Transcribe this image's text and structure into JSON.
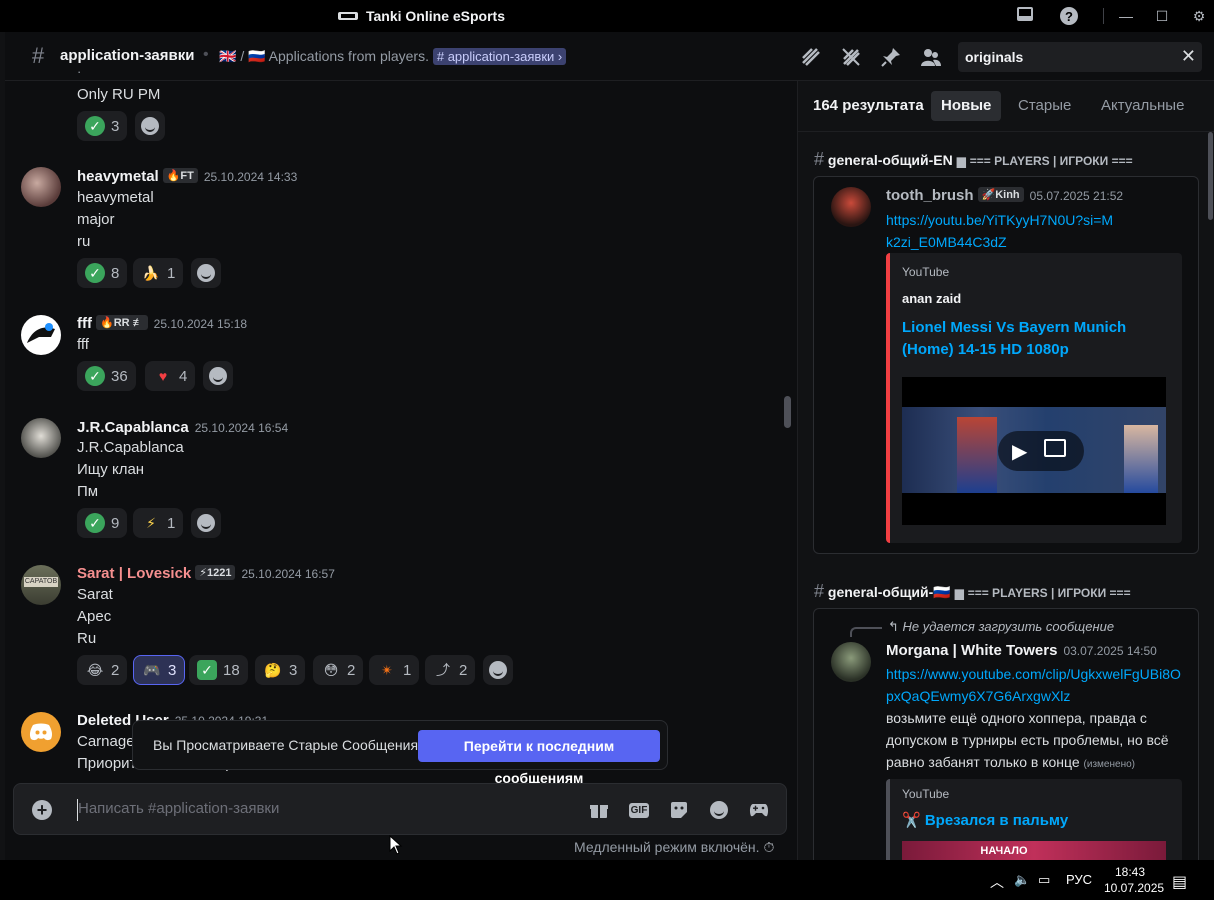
{
  "app": {
    "title": "Tanki Online eSports"
  },
  "channel": {
    "name": "application-заявки",
    "topic_flags": "🇬🇧 / 🇷🇺",
    "topic_text": "Applications from players.",
    "topic_mention": "# application-заявки ›"
  },
  "search": {
    "query": "originals"
  },
  "messages": [
    {
      "lines": [
        "Only RU PM"
      ],
      "reactions": [
        {
          "emoji": "check",
          "count": "3"
        }
      ]
    },
    {
      "user": "heavymetal",
      "tag": "🔥FT",
      "time": "25.10.2024 14:33",
      "lines": [
        "heavymetal",
        "major",
        "ru"
      ],
      "reactions": [
        {
          "emoji": "check",
          "count": "8"
        },
        {
          "emoji": "🍌",
          "count": "1"
        }
      ]
    },
    {
      "user": "fff",
      "tag": "🔥RR ≢",
      "time": "25.10.2024 15:18",
      "lines": [
        "fff"
      ],
      "reactions": [
        {
          "emoji": "check",
          "count": "36"
        },
        {
          "emoji": "❤️",
          "count": "4"
        }
      ]
    },
    {
      "user": "J.R.Capablanca",
      "time": "25.10.2024 16:54",
      "lines": [
        "J.R.Capablanca",
        "Ищу клан",
        "Пм"
      ],
      "reactions": [
        {
          "emoji": "check",
          "count": "9"
        },
        {
          "emoji": "⚡",
          "count": "1"
        }
      ]
    },
    {
      "user": "Sarat | Lovesick",
      "tag": "⚡1221",
      "time": "25.10.2024 16:57",
      "lines": [
        "Sarat",
        "Apec",
        "Ru"
      ],
      "reactions": [
        {
          "emoji": "😂",
          "count": "2"
        },
        {
          "emoji": "🎮",
          "count": "3"
        },
        {
          "emoji": "✅",
          "count": "18"
        },
        {
          "emoji": "🤔",
          "count": "3"
        },
        {
          "emoji": "😳",
          "count": "2"
        },
        {
          "emoji": "✴",
          "count": "1"
        },
        {
          "emoji": "⤴",
          "count": "2"
        }
      ]
    },
    {
      "user": "Deleted User",
      "time": "25.10.2024 19:31",
      "lines": [
        "Carnage",
        "Приоритет викинг и арес"
      ]
    }
  ],
  "old_messages_bar": {
    "text": "Вы Просматриваете Старые Сообщения",
    "button": "Перейти к последним сообщениям"
  },
  "composer": {
    "placeholder": "Написать #application-заявки"
  },
  "slowmode": "Медленный режим включён.",
  "results": {
    "count": "164 результата",
    "tabs": [
      "Новые",
      "Старые",
      "Актуальные"
    ],
    "groups": [
      {
        "channel": "general-общий-EN",
        "category": "=== PLAYERS | ИГРОКИ ===",
        "user": "tooth_brush",
        "tag": "🚀Kinh",
        "time": "05.07.2025 21:52",
        "link": "https://youtu.be/YiTKyyH7N0U?si=Mk2zi_E0MB44C3dZ",
        "embed_provider": "YouTube",
        "embed_author": "anan zaid",
        "embed_title": "Lionel Messi Vs Bayern Munich (Home) 14-15 HD 1080p"
      },
      {
        "channel": "general-общий-🇷🇺",
        "category": "=== PLAYERS | ИГРОКИ ===",
        "reply": "Не удается загрузить сообщение",
        "user": "Morgana | White Towers",
        "time": "03.07.2025 14:50",
        "link": "https://www.youtube.com/clip/UgkxwelFgUBi8OpxQaQEwmy6X7G6ArxgwXlz",
        "text": "возьмите ещё одного хоппера, правда с допуском в турниры есть проблемы, но всё равно забанят только в конце",
        "edited": "(изменено)",
        "embed_provider": "YouTube",
        "embed_title": "✂️ Врезался в пальму",
        "embed_thumb_text": "НАЧАЛО"
      }
    ]
  },
  "taskbar": {
    "lang": "РУС",
    "time": "18:43",
    "date": "10.07.2025"
  }
}
